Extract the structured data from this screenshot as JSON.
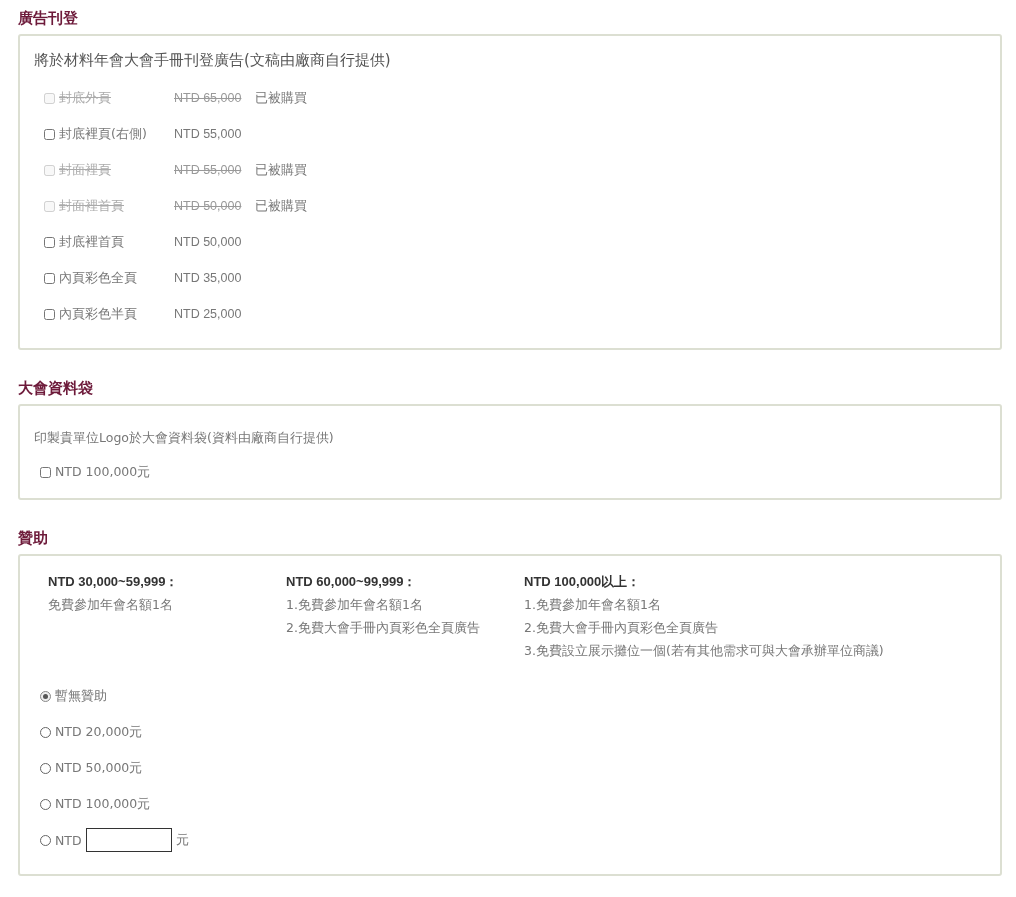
{
  "ads": {
    "title": "廣告刊登",
    "description": "將於材料年會大會手冊刊登廣告(文稿由廠商自行提供)",
    "items": [
      {
        "label": "封底外頁",
        "price": "NTD 65,000",
        "disabled": true,
        "checked": false,
        "status": "已被購買"
      },
      {
        "label": "封底裡頁(右側)",
        "price": "NTD 55,000",
        "disabled": false,
        "checked": false
      },
      {
        "label": "封面裡頁",
        "price": "NTD 55,000",
        "disabled": true,
        "checked": false,
        "status": "已被購買"
      },
      {
        "label": "封面裡首頁",
        "price": "NTD 50,000",
        "disabled": true,
        "checked": false,
        "status": "已被購買"
      },
      {
        "label": "封底裡首頁",
        "price": "NTD 50,000",
        "disabled": false,
        "checked": false
      },
      {
        "label": "內頁彩色全頁",
        "price": "NTD 35,000",
        "disabled": false,
        "checked": false
      },
      {
        "label": "內頁彩色半頁",
        "price": "NTD 25,000",
        "disabled": false,
        "checked": false
      }
    ]
  },
  "bag": {
    "title": "大會資料袋",
    "description": "印製貴單位Logo於大會資料袋(資料由廠商自行提供)",
    "option": {
      "label": "NTD 100,000元",
      "checked": false
    }
  },
  "sponsor": {
    "title": "贊助",
    "tiers": [
      {
        "heading": "NTD 30,000~59,999：",
        "benefits": [
          "免費參加年會名額1名"
        ]
      },
      {
        "heading": "NTD 60,000~99,999：",
        "benefits": [
          "1.免費參加年會名額1名",
          "2.免費大會手冊內頁彩色全頁廣告"
        ]
      },
      {
        "heading": "NTD 100,000以上：",
        "benefits": [
          "1.免費參加年會名額1名",
          "2.免費大會手冊內頁彩色全頁廣告",
          "3.免費設立展示攤位一個(若有其他需求可與大會承辦單位商議)"
        ]
      }
    ],
    "options": [
      {
        "kind": "fixed",
        "label": "暫無贊助",
        "selected": true
      },
      {
        "kind": "fixed",
        "label": "NTD 20,000元",
        "selected": false
      },
      {
        "kind": "fixed",
        "label": "NTD 50,000元",
        "selected": false
      },
      {
        "kind": "fixed",
        "label": "NTD 100,000元",
        "selected": false
      },
      {
        "kind": "custom",
        "label": "NTD",
        "suffix": "元",
        "selected": false
      }
    ]
  }
}
